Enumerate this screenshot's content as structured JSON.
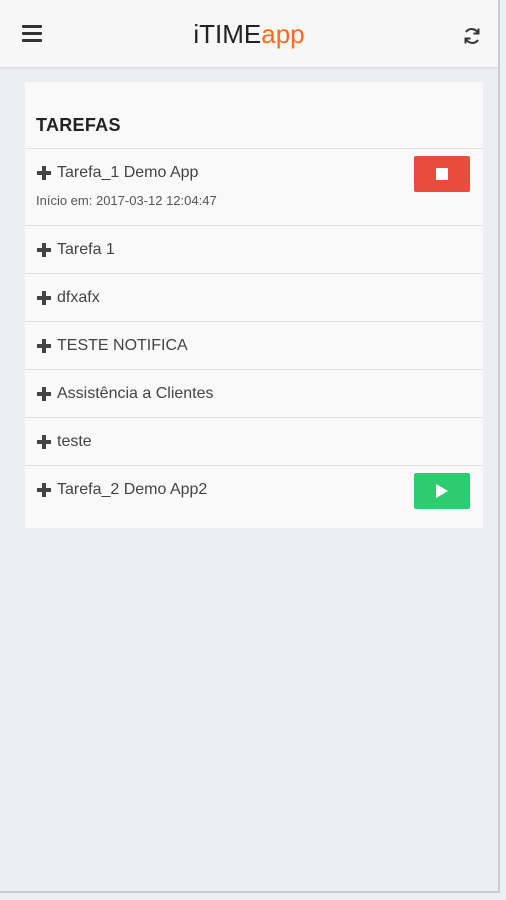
{
  "app": {
    "brand_part1": "iTIME",
    "brand_part2": "app",
    "brand_accent_color": "#f36c21"
  },
  "header": {
    "menu_icon": "hamburger-menu-icon",
    "refresh_icon": "refresh-icon"
  },
  "tasks_panel": {
    "title": "TAREFAS",
    "items": [
      {
        "label": "Tarefa_1 Demo App",
        "subtitle": "Início em: 2017-03-12 12:04:47",
        "action": "stop",
        "action_color": "#e74c3c"
      },
      {
        "label": "Tarefa 1"
      },
      {
        "label": "dfxafx"
      },
      {
        "label": "TESTE NOTIFICA"
      },
      {
        "label": "Assistência a Clientes"
      },
      {
        "label": "teste"
      },
      {
        "label": "Tarefa_2 Demo App2",
        "action": "play",
        "action_color": "#2ecc71"
      }
    ]
  }
}
